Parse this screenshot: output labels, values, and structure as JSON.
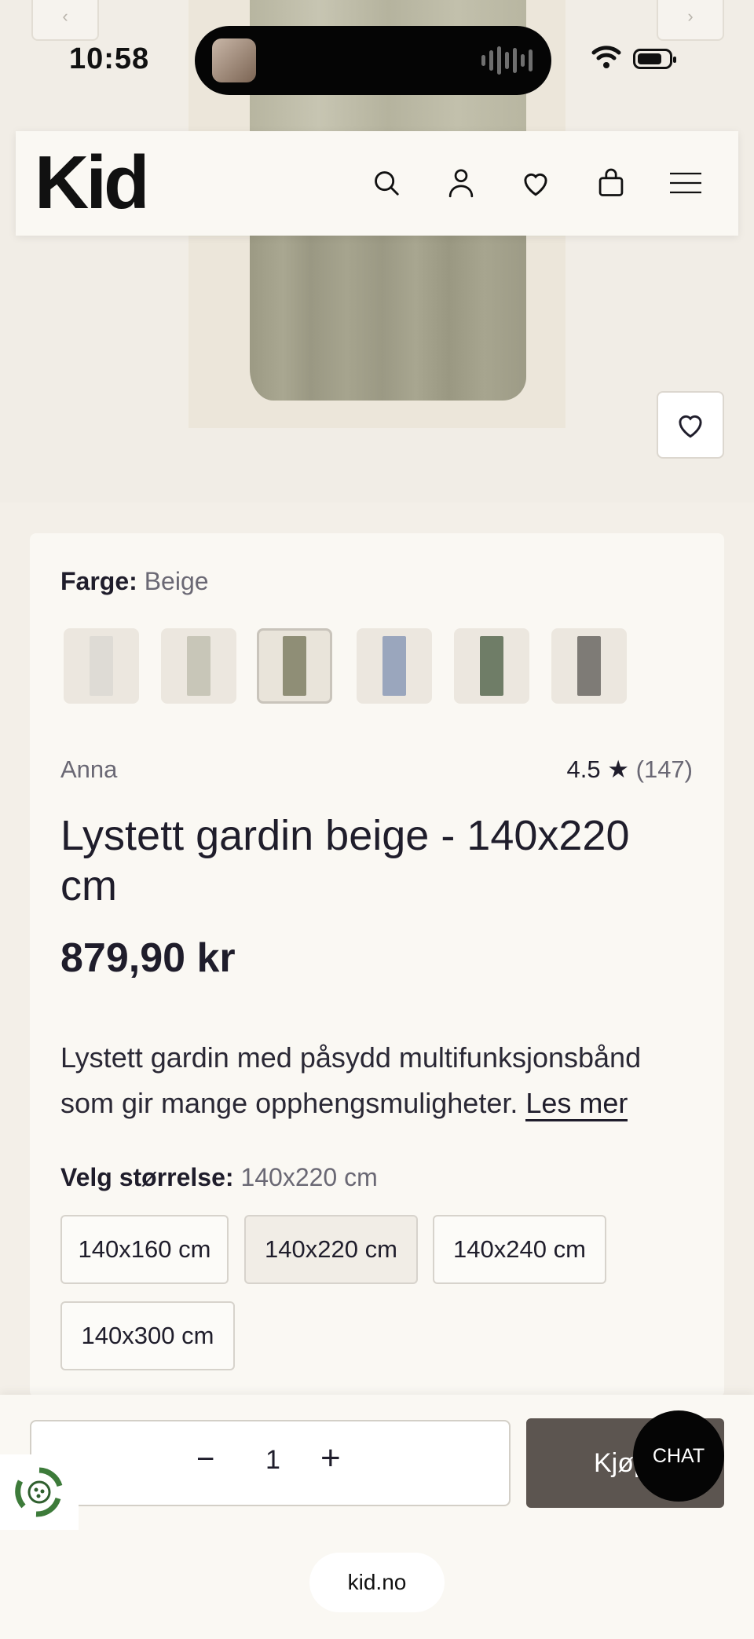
{
  "status_bar": {
    "time": "10:58"
  },
  "header": {
    "logo": "Kid"
  },
  "product": {
    "color_label": "Farge:",
    "color_value": "Beige",
    "swatches": [
      {
        "color": "#dedbd5",
        "selected": false
      },
      {
        "color": "#c8c6b8",
        "selected": false
      },
      {
        "color": "#8f8e76",
        "selected": true
      },
      {
        "color": "#9aa6bd",
        "selected": false
      },
      {
        "color": "#6f7d67",
        "selected": false
      },
      {
        "color": "#7e7b76",
        "selected": false
      }
    ],
    "brand": "Anna",
    "rating_value": "4.5",
    "rating_star": "★",
    "rating_count": "(147)",
    "title": "Lystett gardin beige - 140x220 cm",
    "price": "879,90 kr",
    "description": "Lystett gardin med påsydd multifunksjonsbånd som gir mange opphengsmuligheter.",
    "read_more": "Les mer",
    "size_label": "Velg størrelse:",
    "size_value": "140x220 cm",
    "sizes": [
      "140x160 cm",
      "140x220 cm",
      "140x240 cm",
      "140x300 cm"
    ]
  },
  "purchase": {
    "quantity": "1",
    "minus": "−",
    "plus": "+",
    "buy_label": "Kjøp",
    "chat_label": "CHAT"
  },
  "browser": {
    "url": "kid.no"
  },
  "colors": {
    "accent": "#5c5550",
    "background": "#f3efe8",
    "card": "#faf8f3"
  }
}
